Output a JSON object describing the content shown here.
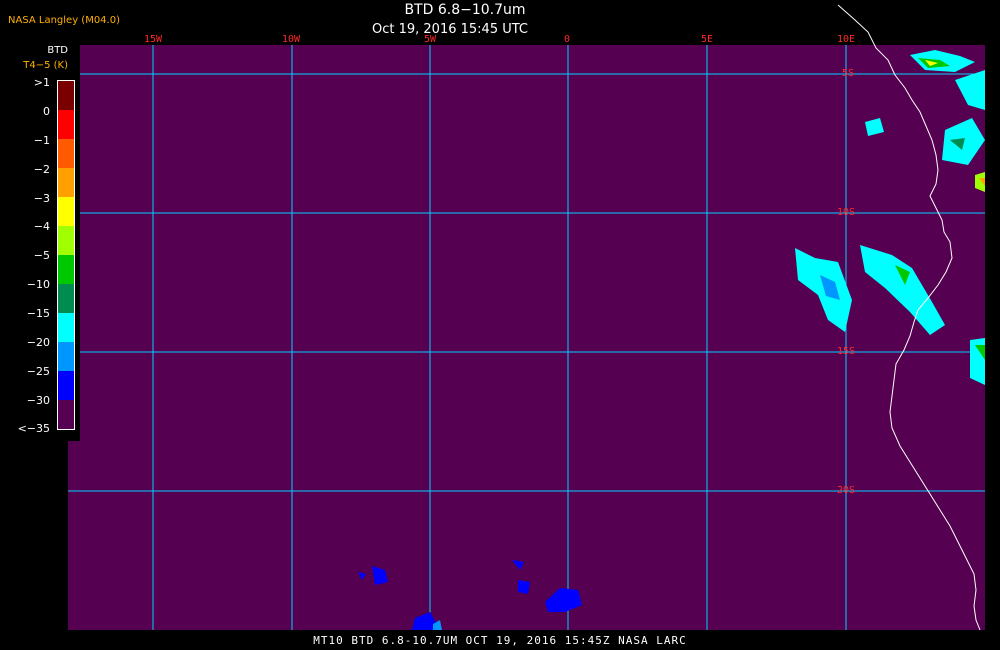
{
  "header": {
    "source": "NASA Langley (M04.0)",
    "title": "BTD 6.8−10.7um",
    "datetime": "Oct 19, 2016 15:45 UTC"
  },
  "longitude_labels": [
    "15W",
    "10W",
    "5W",
    "0",
    "5E",
    "10E"
  ],
  "latitude_labels": [
    "5S",
    "10S",
    "15S",
    "20S"
  ],
  "legend": {
    "title_line1": "BTD",
    "title_line2": "T4−5 (K)",
    "labels": [
      ">1",
      "0",
      "−1",
      "−2",
      "−3",
      "−4",
      "−5",
      "−10",
      "−15",
      "−20",
      "−25",
      "−30",
      "<−35"
    ],
    "colors": [
      "#7a0000",
      "#ff0000",
      "#ff5a00",
      "#ffa000",
      "#ffff00",
      "#a0ff00",
      "#00c800",
      "#008c50",
      "#00ffff",
      "#0096ff",
      "#0000ff",
      "#550050"
    ]
  },
  "footer": "MT10  BTD 6.8-10.7UM   OCT 19, 2016 15:45Z   NASA LARC",
  "colors": {
    "background": "#550050",
    "grid": "#00d0ff",
    "coast": "#ffffff",
    "label": "#ff2a2a"
  }
}
